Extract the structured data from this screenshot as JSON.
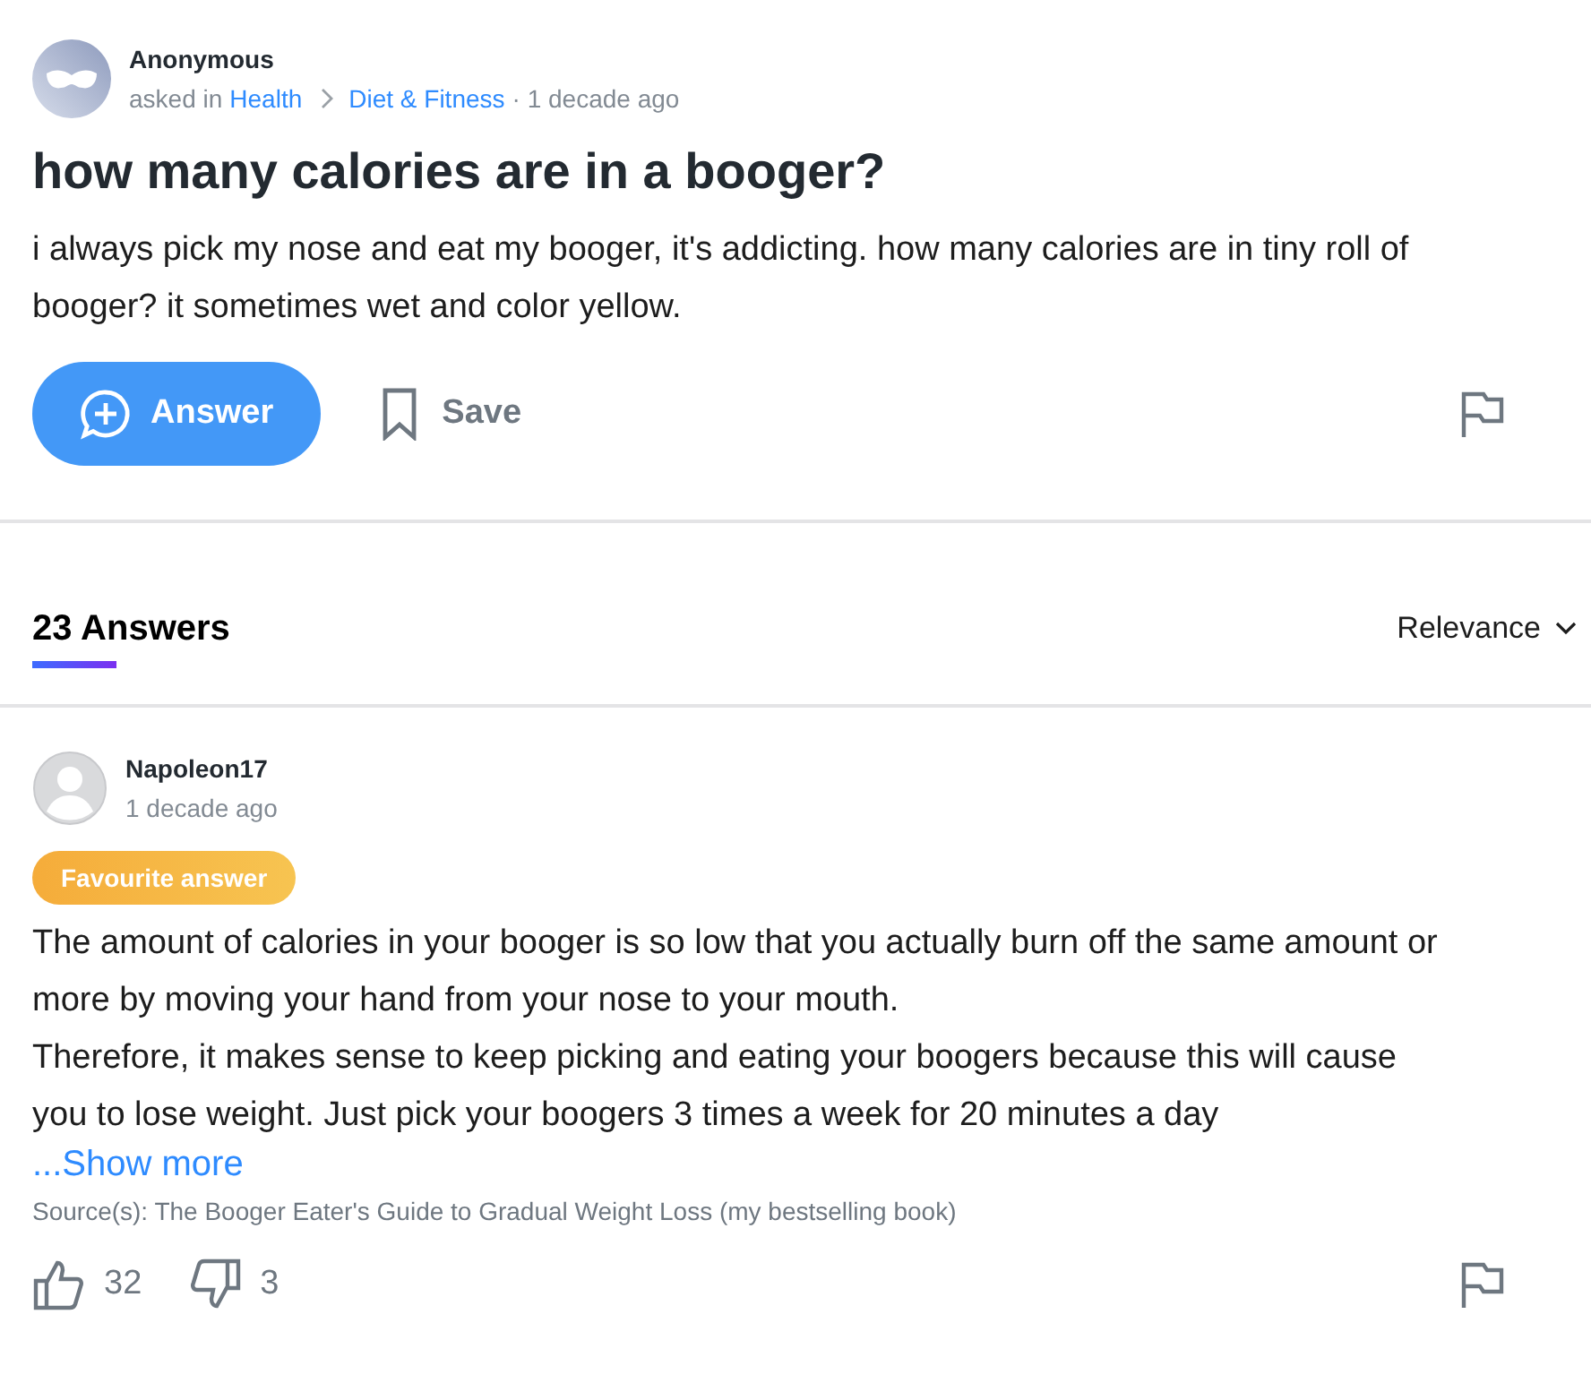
{
  "question": {
    "author": "Anonymous",
    "asked_in": "asked in",
    "categories": [
      "Health",
      "Diet & Fitness"
    ],
    "time": "· 1 decade ago",
    "title": "how many calories are in a booger?",
    "body": "i always pick my nose and eat my booger, it's addicting. how many calories are in tiny roll of booger? it sometimes wet and color yellow."
  },
  "actions": {
    "answer": "Answer",
    "save": "Save"
  },
  "answers_header": {
    "count": "23 Answers",
    "sort": "Relevance"
  },
  "answers": [
    {
      "author": "Napoleon17",
      "time": "1 decade ago",
      "badge": "Favourite answer",
      "paragraphs": [
        "The amount of calories in your booger is so low that you actually burn off the same amount or more by moving your hand from your nose to your mouth.",
        "Therefore, it makes sense to keep picking and eating your boogers because this will cause you to lose weight. Just pick your boogers 3 times a week for 20 minutes a day"
      ],
      "show_more": "...Show more",
      "source": "Source(s): The Booger Eater's Guide to Gradual Weight Loss (my bestselling book)",
      "likes": "32",
      "dislikes": "3"
    }
  ]
}
